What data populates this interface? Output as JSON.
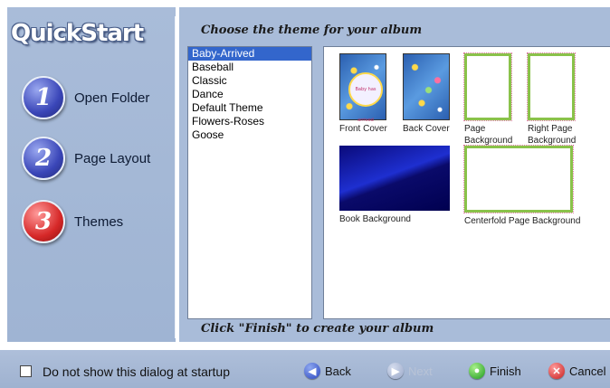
{
  "sidebar": {
    "brand": "QuickStart",
    "steps": [
      {
        "number": "1",
        "label": "Open Folder"
      },
      {
        "number": "2",
        "label": "Page Layout"
      },
      {
        "number": "3",
        "label": "Themes"
      }
    ]
  },
  "main": {
    "heading": "Choose the theme for your album",
    "footer_note": "Click \"Finish\" to create your album",
    "themes": [
      "Baby-Arrived",
      "Baseball",
      "Classic",
      "Dance",
      "Default Theme",
      "Flowers-Roses",
      "Goose"
    ],
    "selected_theme": "Baby-Arrived",
    "preview": {
      "front_cover": "Front Cover",
      "back_cover": "Back Cover",
      "page_background": "Page Background",
      "right_page_background": "Right Page Background",
      "book_background": "Book Background",
      "centerfold_background": "Centerfold Page Background",
      "cover_text": "Baby has arrived"
    }
  },
  "bottom": {
    "checkbox_label": "Do not show this dialog at startup",
    "back": "Back",
    "next": "Next",
    "finish": "Finish",
    "cancel": "Cancel"
  },
  "colors": {
    "panel": "#a9bcd9",
    "selection": "#3366cc",
    "step_active": "#d62828",
    "step_inactive": "#3a46b8"
  }
}
